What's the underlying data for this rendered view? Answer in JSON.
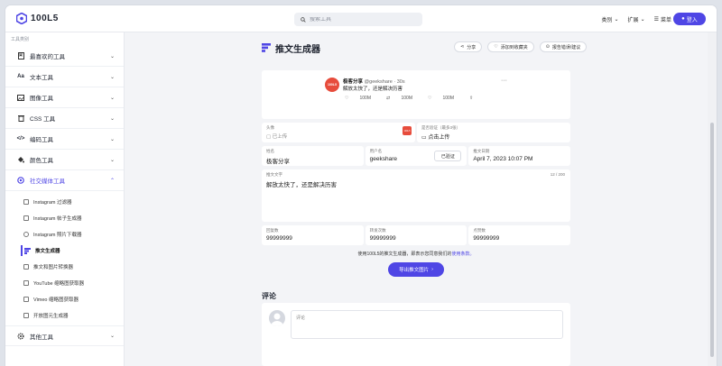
{
  "header": {
    "logo_text": "100L5",
    "search_placeholder": "搜索工具",
    "nav": [
      "类别",
      "扩展",
      "菜单"
    ],
    "login_label": "登入"
  },
  "sidebar": {
    "title": "工具类别",
    "groups": [
      {
        "label": "最喜欢的工具",
        "icon": "bookmark-icon"
      },
      {
        "label": "文本工具",
        "icon": "text-icon"
      },
      {
        "label": "图像工具",
        "icon": "image-icon"
      },
      {
        "label": "CSS 工具",
        "icon": "trash-icon"
      },
      {
        "label": "编码工具",
        "icon": "code-icon"
      },
      {
        "label": "颜色工具",
        "icon": "paint-bucket-icon"
      },
      {
        "label": "社交媒体工具",
        "icon": "social-icon"
      }
    ],
    "sub_items": [
      "Instagram 过滤器",
      "Instagram 帖子生成器",
      "Instagram 照片下载器",
      "推文生成器",
      "推文和图片转换器",
      "YouTube 缩略图获取器",
      "Vimeo 缩略图获取器",
      "开放图元生成器"
    ],
    "other_group": "其他工具"
  },
  "page": {
    "title": "推文生成器",
    "actions": [
      "分享",
      "添加到收藏夹",
      "报告错误/建议"
    ]
  },
  "tweet": {
    "avatar_text": "100L5",
    "name": "极客分享",
    "handle": "@geekshare · 30s",
    "text": "解放太快了，还是解决历害",
    "stats": [
      "100M",
      "100M",
      "100M"
    ],
    "more": "···"
  },
  "fields": {
    "avatar_label": "头像",
    "avatar_value": "已上传",
    "verify_label": "是否验证（最多3张）",
    "verify_value": "点击上传",
    "name_label": "姓名",
    "name_value": "极客分享",
    "username_label": "用户名",
    "username_value": "geekshare",
    "verified_btn": "已验证",
    "date_label": "推文日期",
    "date_value": "April 7, 2023 10:07 PM",
    "content_label": "推文文字",
    "content_count": "12 / 200",
    "content_value": "解放太快了，还是解决历害",
    "retweets_label": "回复数",
    "retweets_value": "99999999",
    "quotes_label": "转发次数",
    "quotes_value": "99999999",
    "likes_label": "点赞数",
    "likes_value": "99999999"
  },
  "note": {
    "text": "使用100L5的推文生成器，即表示您同意我们的",
    "link": "使用条款。"
  },
  "export_label": "导出推文图片",
  "comments": {
    "title": "评论",
    "placeholder": "评论"
  }
}
